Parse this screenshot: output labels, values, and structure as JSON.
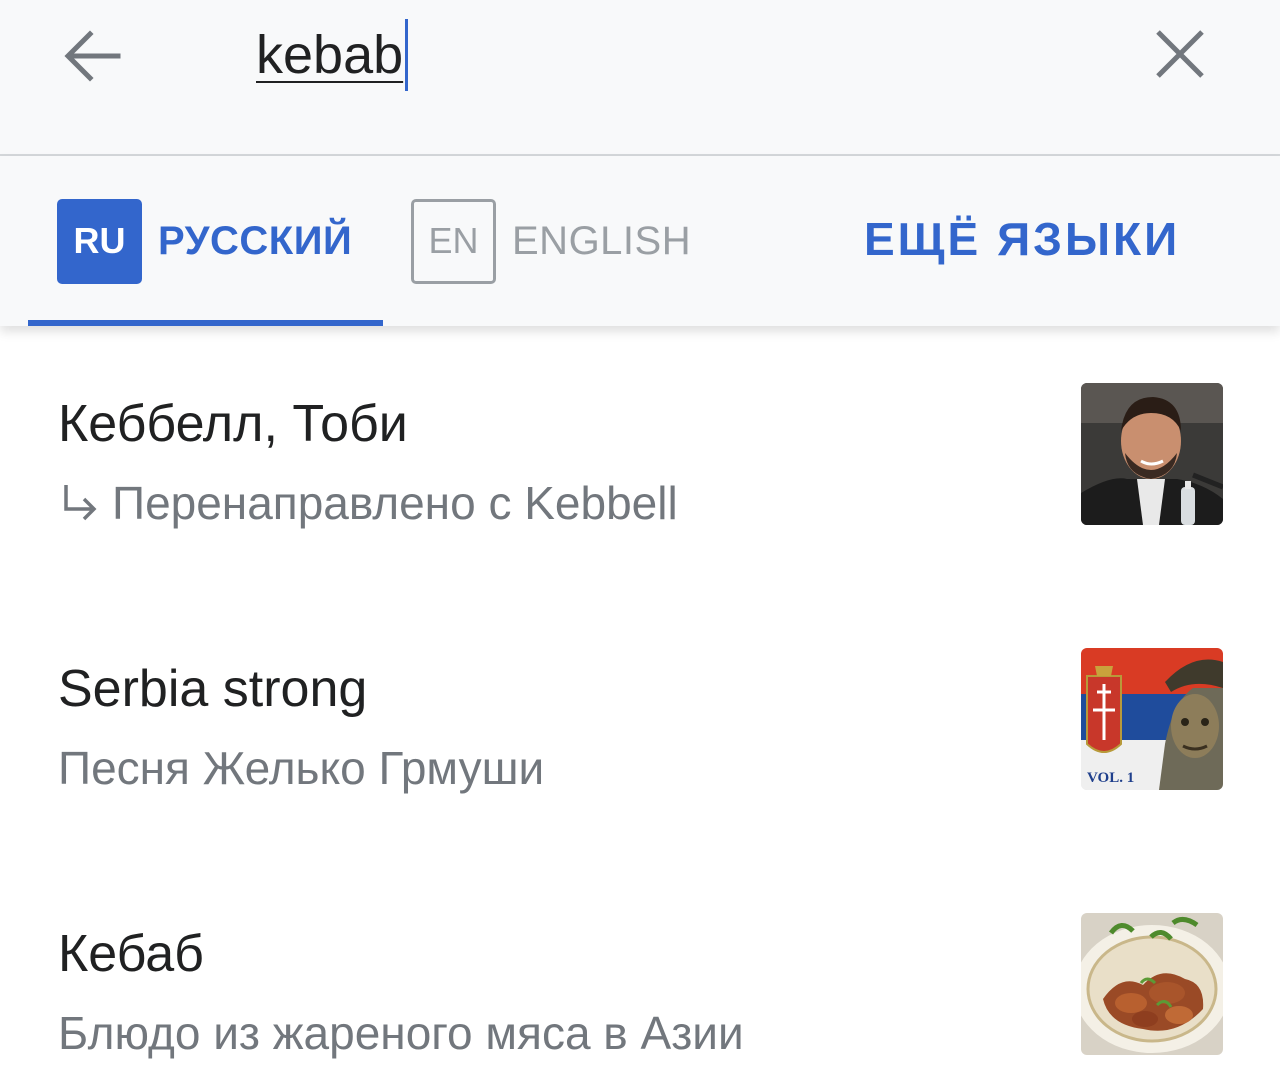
{
  "search": {
    "query": "kebab"
  },
  "languages": {
    "tabs": [
      {
        "code": "RU",
        "label": "РУССКИЙ",
        "active": true
      },
      {
        "code": "EN",
        "label": "ENGLISH",
        "active": false
      }
    ],
    "more_label": "ЕЩЁ ЯЗЫКИ"
  },
  "results": [
    {
      "title": "Кеббелл, Тоби",
      "description": "Перенаправлено с Kebbell",
      "redirect": true,
      "thumbnail": "person-photo"
    },
    {
      "title": "Serbia strong",
      "description": "Песня Желько Грмуши",
      "redirect": false,
      "thumbnail": "album-cover",
      "thumbnail_text": "VOL. 1"
    },
    {
      "title": "Кебаб",
      "description": "Блюдо из жареного мяса в Азии",
      "redirect": false,
      "thumbnail": "food-photo"
    }
  ],
  "icons": {
    "back": "arrow-left-icon",
    "clear": "close-icon",
    "redirect": "redirect-arrow-icon"
  },
  "colors": {
    "accent": "#3366cc",
    "header_bg": "#f8f9fa",
    "text_primary": "#202122",
    "text_secondary": "#72777d",
    "inactive": "#9a9fa4"
  }
}
